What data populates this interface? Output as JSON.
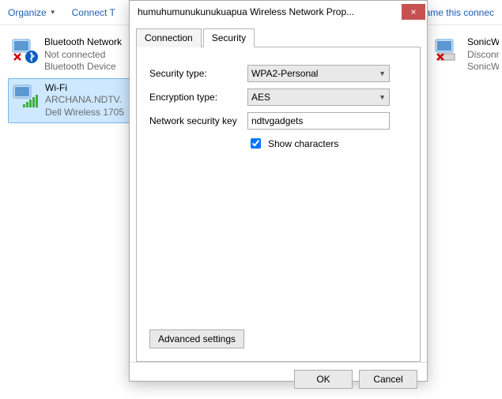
{
  "toolbar": {
    "organize": "Organize",
    "connect": "Connect T",
    "rename": "hame this connec"
  },
  "connections": {
    "left": [
      {
        "name": "Bluetooth Network",
        "sub1": "Not connected",
        "sub2": "Bluetooth Device",
        "icon": "bluetooth"
      },
      {
        "name": "Wi-Fi",
        "sub1": "ARCHANA.NDTV.",
        "sub2": "Dell Wireless 1705",
        "icon": "wifi",
        "selected": true
      }
    ],
    "right": [
      {
        "name": "SonicWALL I",
        "sub1": "Disconnecte",
        "sub2": "SonicWALL I",
        "icon": "sonicwall"
      }
    ]
  },
  "dialog": {
    "title": "humuhumunukunukuapua Wireless Network Prop...",
    "tabs": {
      "connection": "Connection",
      "security": "Security"
    },
    "security": {
      "security_type_label": "Security type:",
      "security_type_value": "WPA2-Personal",
      "encryption_type_label": "Encryption type:",
      "encryption_type_value": "AES",
      "network_key_label": "Network security key",
      "network_key_value": "ndtvgadgets",
      "show_characters_label": "Show characters",
      "show_characters_checked": true,
      "advanced_button": "Advanced settings"
    },
    "footer": {
      "ok": "OK",
      "cancel": "Cancel"
    }
  }
}
